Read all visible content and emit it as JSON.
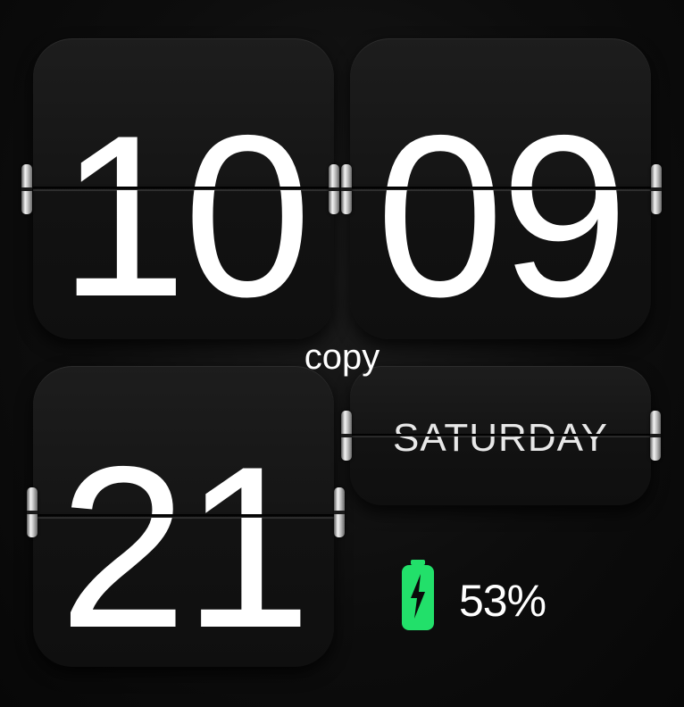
{
  "clock": {
    "hours": "10",
    "minutes": "09"
  },
  "date": {
    "day_number": "21",
    "weekday": "SATURDAY"
  },
  "overlay": {
    "label": "copy"
  },
  "battery": {
    "level_percent": 53,
    "label": "53%",
    "charging": true,
    "icon": "battery-charging-icon",
    "accent_color": "#22e06a"
  },
  "colors": {
    "background": "#0b0b0b",
    "card": "#161616",
    "digit": "#ffffff"
  }
}
